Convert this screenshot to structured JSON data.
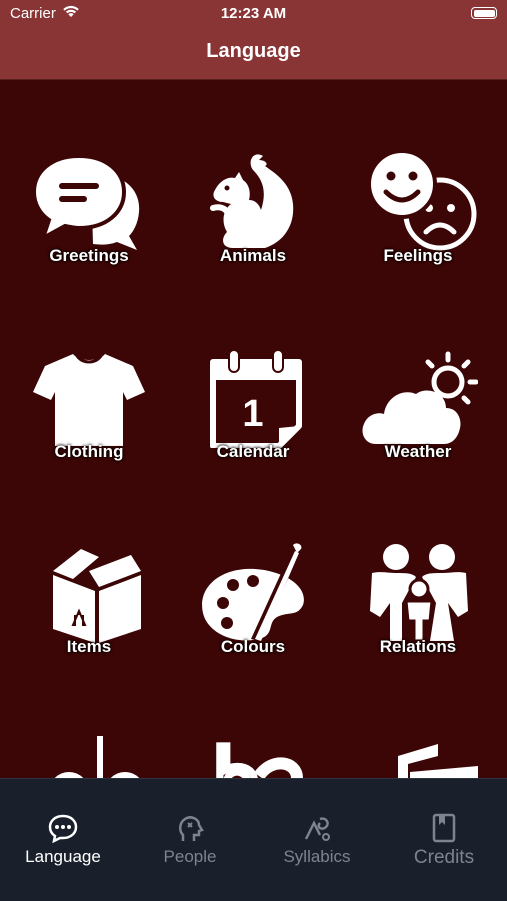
{
  "status": {
    "carrier": "Carrier",
    "time": "12:23 AM"
  },
  "nav": {
    "title": "Language"
  },
  "categories": [
    {
      "label": "Greetings",
      "icon": "speech-bubbles-icon"
    },
    {
      "label": "Animals",
      "icon": "squirrel-icon"
    },
    {
      "label": "Feelings",
      "icon": "happy-sad-faces-icon"
    },
    {
      "label": "Clothing",
      "icon": "t-shirt-icon"
    },
    {
      "label": "Calendar",
      "icon": "calendar-icon"
    },
    {
      "label": "Weather",
      "icon": "sun-cloud-icon"
    },
    {
      "label": "Items",
      "icon": "box-icon"
    },
    {
      "label": "Colours",
      "icon": "palette-icon"
    },
    {
      "label": "Relations",
      "icon": "family-icon"
    }
  ],
  "calendar_day": "1",
  "tabs": [
    {
      "label": "Language",
      "icon": "chat-bubble-icon",
      "active": true
    },
    {
      "label": "People",
      "icon": "head-icon",
      "active": false
    },
    {
      "label": "Syllabics",
      "icon": "syllabics-icon",
      "active": false
    },
    {
      "label": "Credits",
      "icon": "book-icon",
      "active": false
    }
  ],
  "colors": {
    "background": "#3d0606",
    "header": "#8a3535",
    "tabbar": "#19202b",
    "tab_inactive": "#7d8490",
    "tab_active": "#ffffff"
  }
}
